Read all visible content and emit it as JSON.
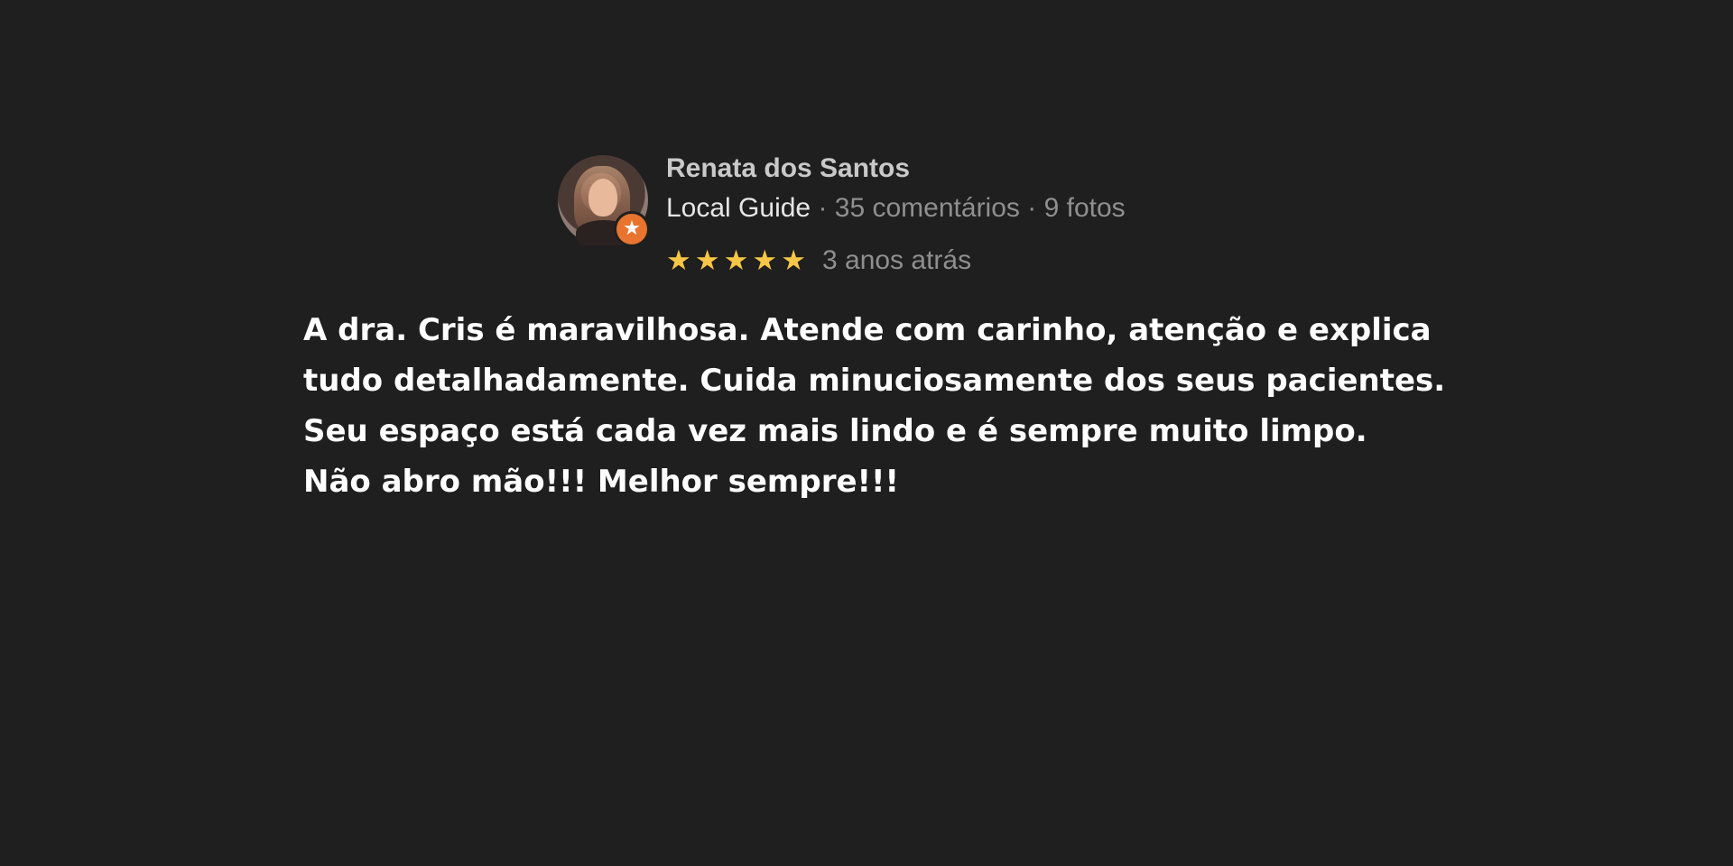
{
  "review": {
    "reviewer_name": "Renata dos Santos",
    "badge_label": "Local Guide",
    "comments_count": "35 comentários",
    "photos_count": "9 fotos",
    "separator": "·",
    "rating": 5,
    "rating_max": 5,
    "time_ago": "3 anos atrás",
    "text_lines": [
      "A dra. Cris é maravilhosa. Atende com carinho, atenção e explica",
      "tudo detalhadamente. Cuida minuciosamente dos seus pacientes.",
      "Seu espaço está cada vez mais lindo e é sempre muito limpo.",
      "Não abro mão!!! Melhor sempre!!!"
    ]
  },
  "icons": {
    "star": "★",
    "badge_star": "★"
  },
  "colors": {
    "background": "#1f1f1f",
    "star": "#f8c646",
    "badge": "#e8742f",
    "text": "#ffffff",
    "muted": "#8f8f8f"
  }
}
